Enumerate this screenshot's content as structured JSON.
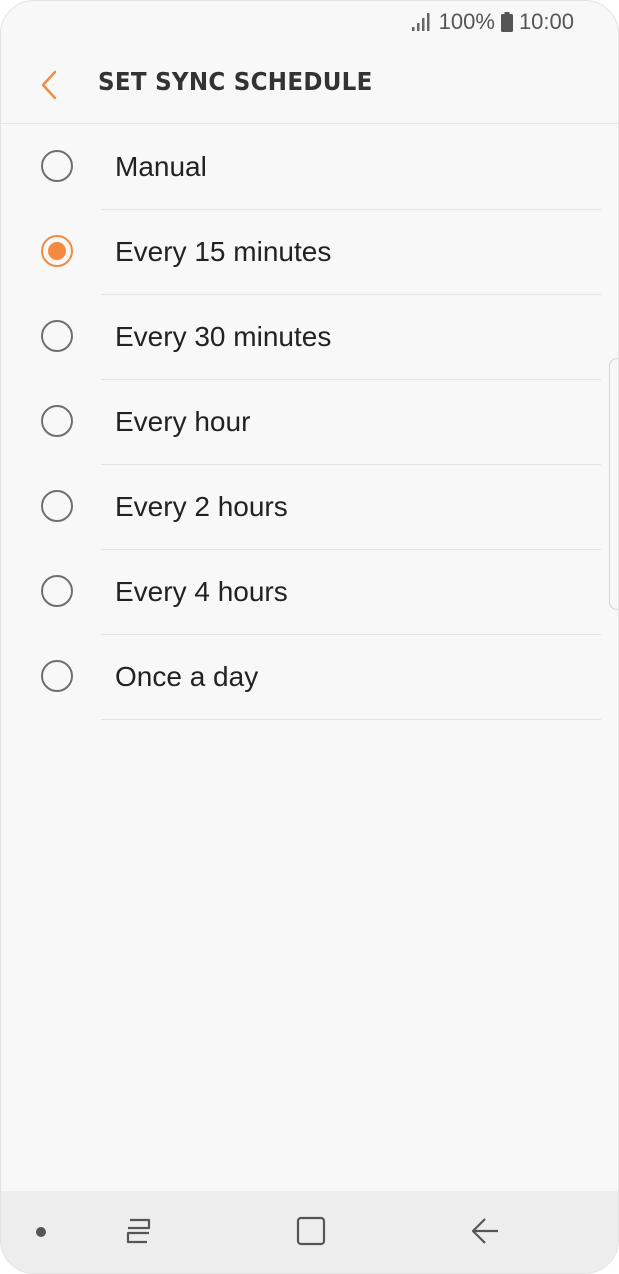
{
  "status_bar": {
    "battery_percent": "100%",
    "time": "10:00",
    "icons": [
      "signal-icon",
      "battery-icon"
    ]
  },
  "app_bar": {
    "title": "SET SYNC SCHEDULE",
    "back_icon": "chevron-left-icon"
  },
  "accent_color": "#f5893f",
  "options": [
    {
      "label": "Manual",
      "selected": false
    },
    {
      "label": "Every 15 minutes",
      "selected": true
    },
    {
      "label": "Every 30 minutes",
      "selected": false
    },
    {
      "label": "Every hour",
      "selected": false
    },
    {
      "label": "Every 2 hours",
      "selected": false
    },
    {
      "label": "Every 4 hours",
      "selected": false
    },
    {
      "label": "Once a day",
      "selected": false
    }
  ],
  "nav_bar": {
    "buttons": [
      "recent-apps-icon",
      "home-icon",
      "back-icon"
    ]
  }
}
